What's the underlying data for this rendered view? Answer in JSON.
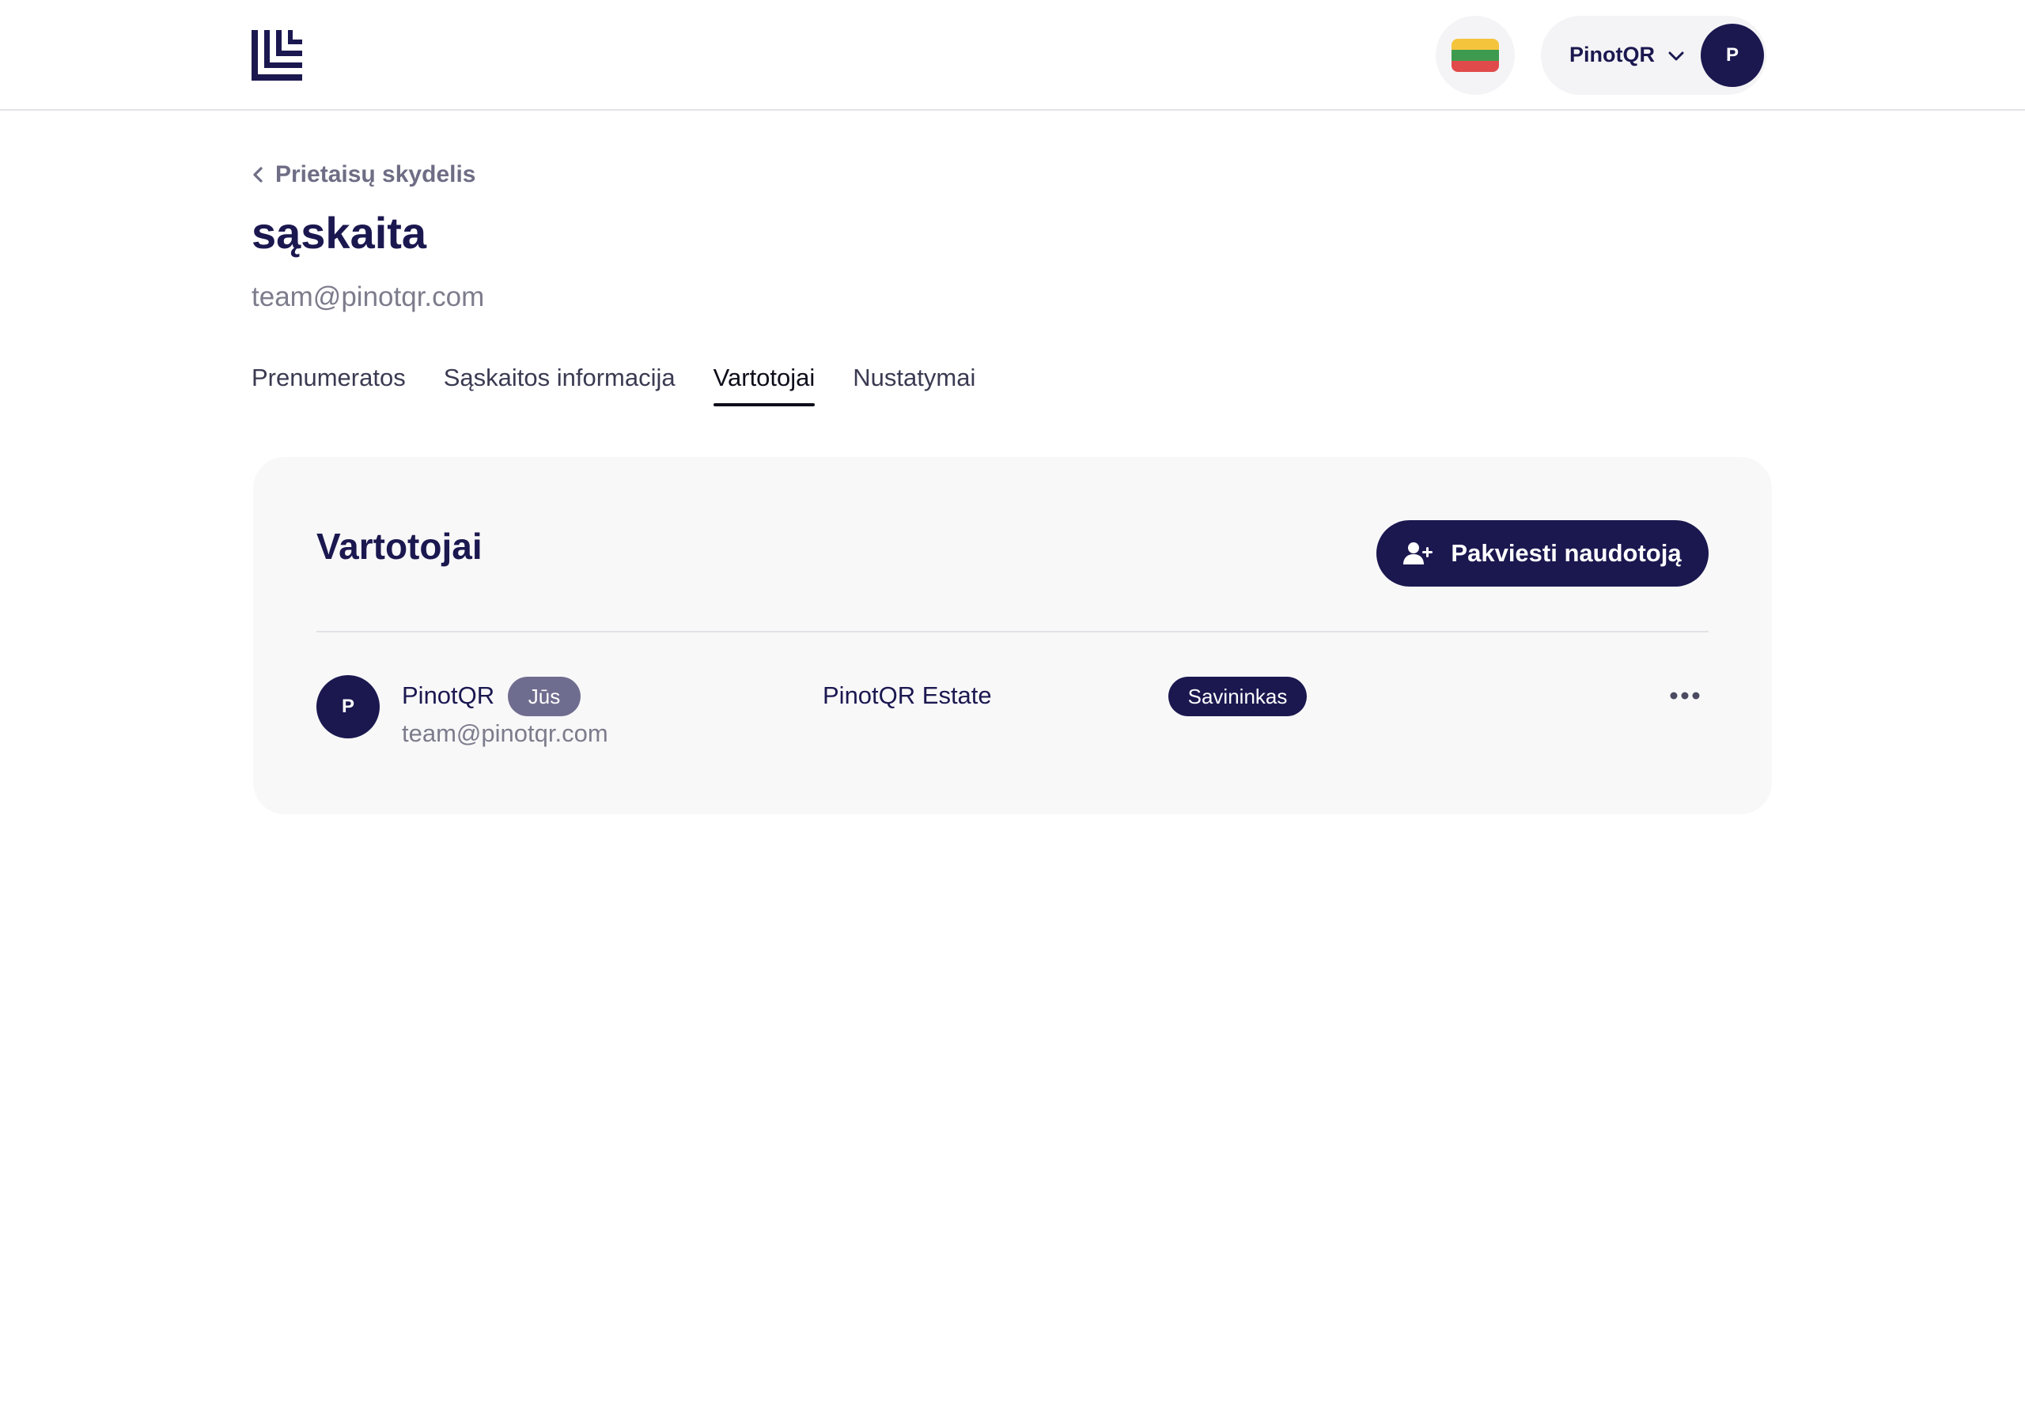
{
  "header": {
    "logo_icon": "logo-icon",
    "language": {
      "icon": "flag-lithuania-icon",
      "colors": [
        "#f5c43d",
        "#3e9a4f",
        "#e14a4a"
      ]
    },
    "account": {
      "name": "PinotQR",
      "avatar_initial": "P"
    }
  },
  "breadcrumb": {
    "label": "Prietaisų skydelis"
  },
  "page": {
    "title": "sąskaita",
    "email": "team@pinotqr.com"
  },
  "tabs": [
    {
      "label": "Prenumeratos",
      "active": false
    },
    {
      "label": "Sąskaitos informacija",
      "active": false
    },
    {
      "label": "Vartotojai",
      "active": true
    },
    {
      "label": "Nustatymai",
      "active": false
    }
  ],
  "users_card": {
    "title": "Vartotojai",
    "invite_label": "Pakviesti naudotoją",
    "rows": [
      {
        "avatar_initial": "P",
        "name": "PinotQR",
        "you_badge": "Jūs",
        "email": "team@pinotqr.com",
        "organization": "PinotQR Estate",
        "role": "Savininkas"
      }
    ]
  },
  "colors": {
    "brand_navy": "#1b1850",
    "badge_gray": "#6f6d8f",
    "card_bg": "#f8f8f9"
  }
}
